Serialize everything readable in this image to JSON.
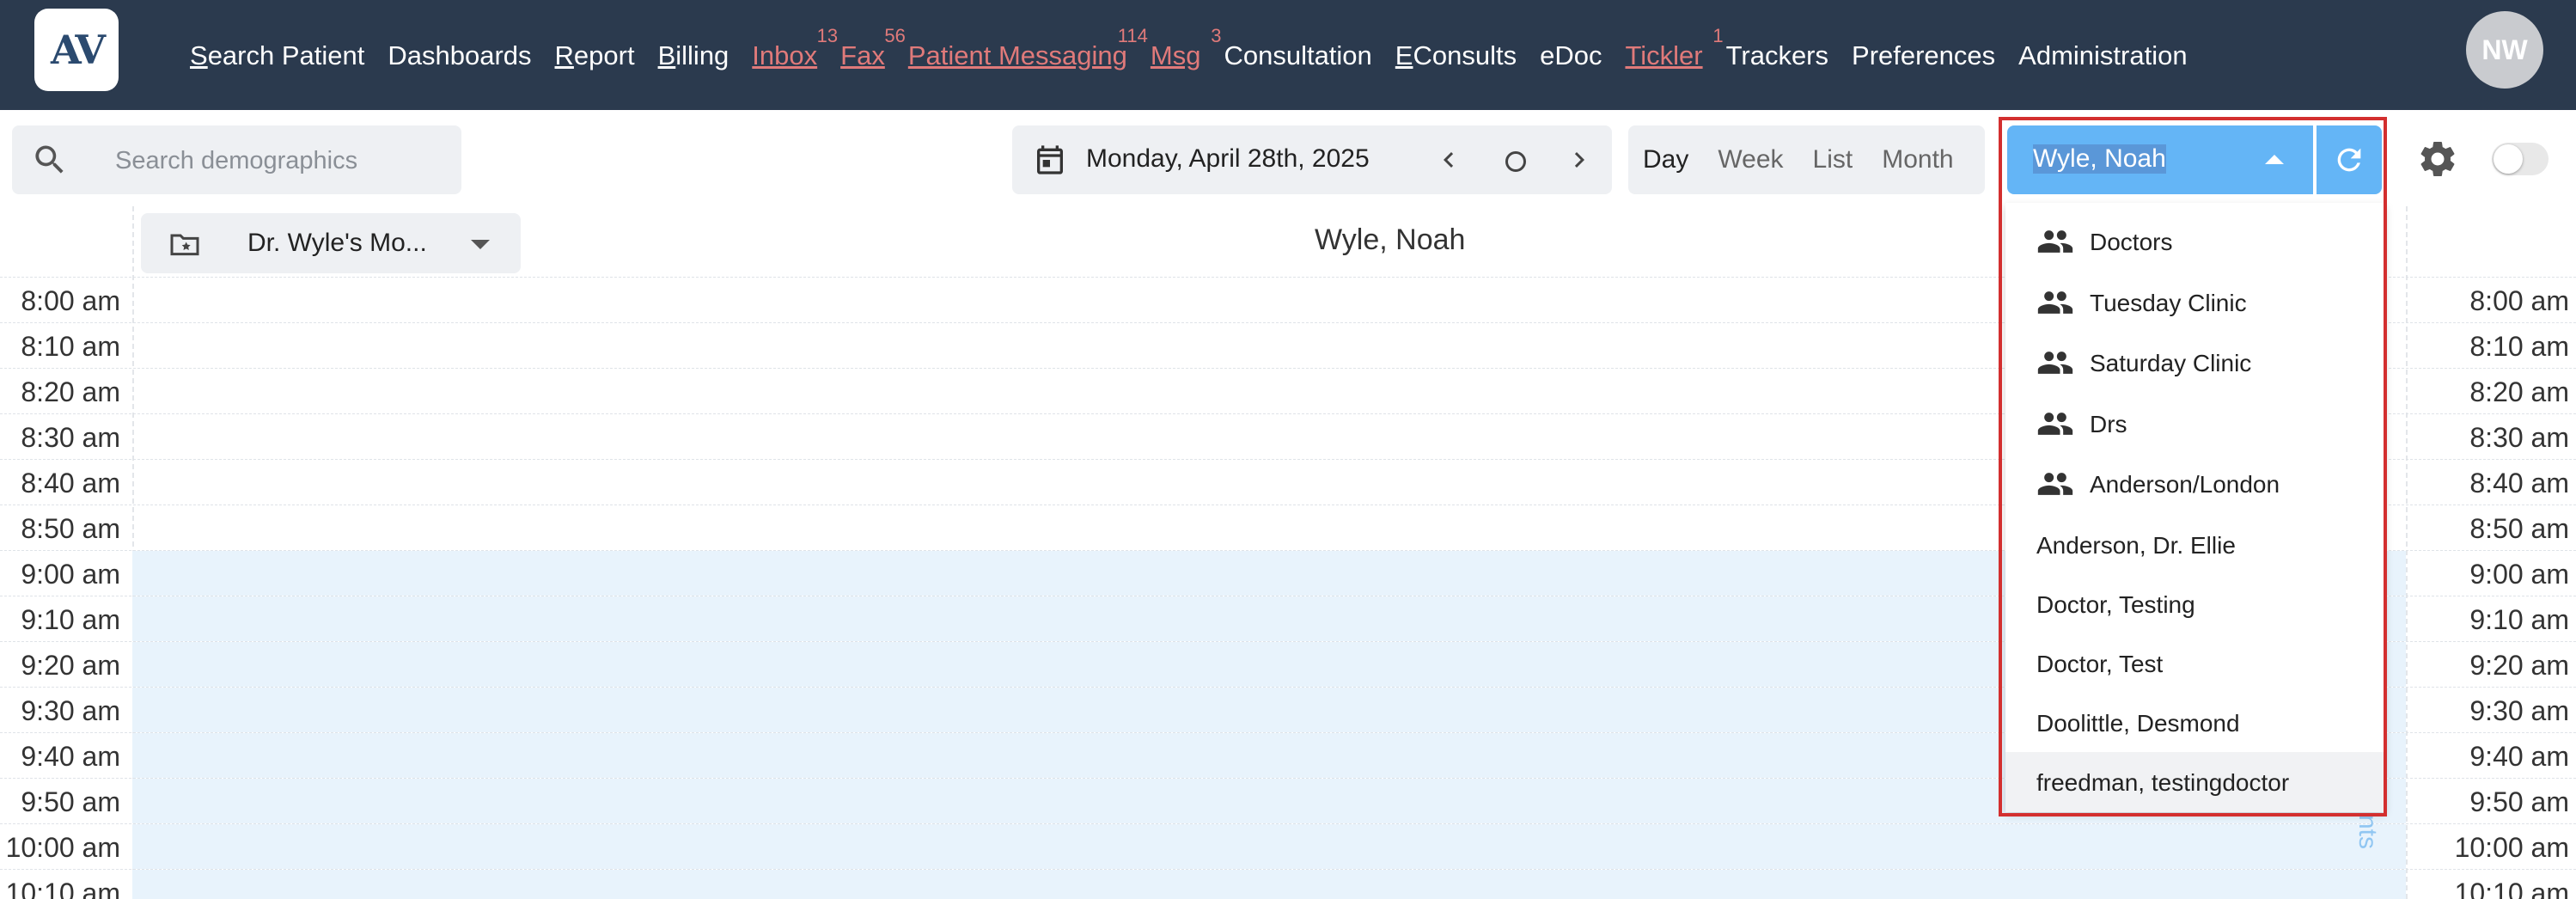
{
  "app": {
    "logo_text": "AV"
  },
  "nav": {
    "items": [
      {
        "label": "Search Patient",
        "underline": "S",
        "rest": "earch Patient",
        "alert": false,
        "badge": ""
      },
      {
        "label": "Dashboards",
        "underline": "",
        "rest": "Dashboards",
        "alert": false,
        "badge": ""
      },
      {
        "label": "Report",
        "underline": "R",
        "rest": "eport",
        "alert": false,
        "badge": ""
      },
      {
        "label": "Billing",
        "underline": "B",
        "rest": "illing",
        "alert": false,
        "badge": ""
      },
      {
        "label": "Inbox",
        "underline": "",
        "rest": "Inbox",
        "alert": true,
        "badge": "13"
      },
      {
        "label": "Fax",
        "underline": "",
        "rest": "Fax",
        "alert": true,
        "badge": "56"
      },
      {
        "label": "Patient Messaging",
        "underline": "",
        "rest": "Patient Messaging",
        "alert": true,
        "badge": "114"
      },
      {
        "label": "Msg",
        "underline": "",
        "rest": "Msg",
        "alert": true,
        "badge": "3"
      },
      {
        "label": "Consultation",
        "underline": "",
        "rest": "Consultation",
        "alert": false,
        "badge": ""
      },
      {
        "label": "EConsults",
        "underline": "E",
        "rest": "Consults",
        "alert": false,
        "badge": ""
      },
      {
        "label": "eDoc",
        "underline": "",
        "rest": "eDoc",
        "alert": false,
        "badge": ""
      },
      {
        "label": "Tickler",
        "underline": "",
        "rest": "Tickler",
        "alert": true,
        "badge": "1"
      },
      {
        "label": "Trackers",
        "underline": "",
        "rest": "Trackers",
        "alert": false,
        "badge": ""
      },
      {
        "label": "Preferences",
        "underline": "",
        "rest": "Preferences",
        "alert": false,
        "badge": ""
      },
      {
        "label": "Administration",
        "underline": "",
        "rest": "Administration",
        "alert": false,
        "badge": ""
      }
    ],
    "avatar_initials": "NW"
  },
  "toolbar": {
    "search_placeholder": "Search demographics",
    "date": "Monday, April 28th, 2025",
    "views": [
      "Day",
      "Week",
      "List",
      "Month"
    ],
    "active_view": "Day",
    "provider": "Wyle, Noah"
  },
  "schedule": {
    "template": "Dr. Wyle's Mo...",
    "column_header": "Wyle, Noah"
  },
  "times": [
    "8:00 am",
    "8:10 am",
    "8:20 am",
    "8:30 am",
    "8:40 am",
    "8:50 am",
    "9:00 am",
    "9:10 am",
    "9:20 am",
    "9:30 am",
    "9:40 am",
    "9:50 am",
    "10:00 am",
    "10:10 am"
  ],
  "availability": [
    false,
    false,
    false,
    false,
    false,
    false,
    true,
    true,
    true,
    true,
    true,
    true,
    true,
    true
  ],
  "dropdown": {
    "groups": [
      "Doctors",
      "Tuesday Clinic",
      "Saturday Clinic",
      "Drs",
      "Anderson/London"
    ],
    "providers": [
      "Anderson, Dr. Ellie",
      "Doctor, Testing",
      "Doctor, Test",
      "Doolittle, Desmond",
      "freedman, testingdoctor"
    ]
  },
  "side_label": "nts",
  "colors": {
    "nav_bg": "#2b3a4e",
    "alert": "#e07a7a",
    "accent": "#64b5f6",
    "available": "#e8f3fc",
    "highlight": "#d32f2f"
  }
}
